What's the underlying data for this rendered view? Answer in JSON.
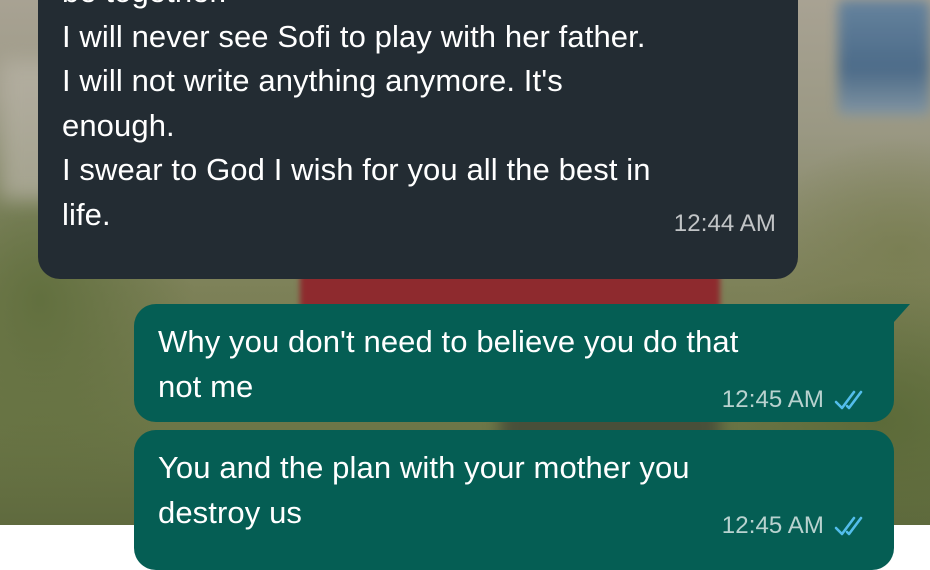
{
  "messages": [
    {
      "direction": "incoming",
      "text": "be together.\nI will never see Sofi to play with her father.\nI will not write anything anymore. It's\nenough.\nI swear to God I wish for you all the best in\nlife.",
      "time": "12:44 AM"
    },
    {
      "direction": "outgoing",
      "text": "Why you don't need to believe you do that\nnot me",
      "time": "12:45 AM",
      "status_icon": "double-check-read-icon"
    },
    {
      "direction": "outgoing",
      "text": "You and the plan with your mother you\ndestroy us",
      "time": "12:45 AM",
      "status_icon": "double-check-read-icon"
    }
  ],
  "colors": {
    "incoming_bubble": "#232c33",
    "outgoing_bubble": "#055e54",
    "read_ticks": "#53bdeb",
    "text": "#ffffff"
  }
}
